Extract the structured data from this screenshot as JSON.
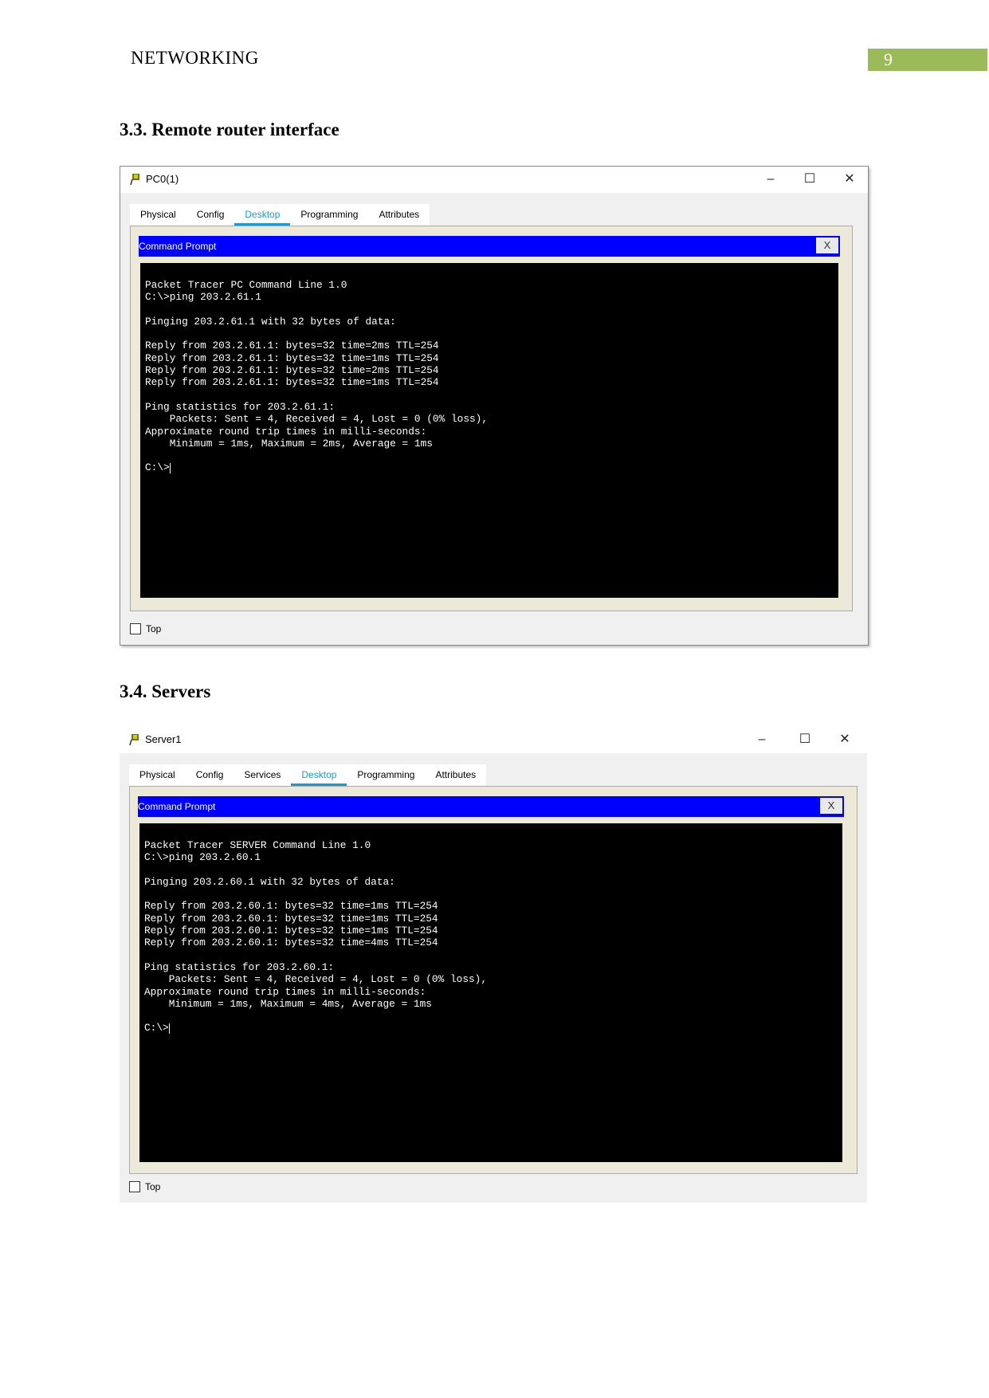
{
  "header": {
    "title": "NETWORKING",
    "page_number": "9",
    "accent_color": "#9bbb59"
  },
  "section1": {
    "heading": "3.3. Remote router interface",
    "window": {
      "title": "PC0(1)",
      "tabs": [
        "Physical",
        "Config",
        "Desktop",
        "Programming",
        "Attributes"
      ],
      "active_tab": "Desktop",
      "cmd_title": "Command Prompt",
      "cmd_close": "X",
      "top_label": "Top",
      "lines": [
        "Packet Tracer PC Command Line 1.0",
        "C:\\>ping 203.2.61.1",
        "",
        "Pinging 203.2.61.1 with 32 bytes of data:",
        "",
        "Reply from 203.2.61.1: bytes=32 time=2ms TTL=254",
        "Reply from 203.2.61.1: bytes=32 time=1ms TTL=254",
        "Reply from 203.2.61.1: bytes=32 time=2ms TTL=254",
        "Reply from 203.2.61.1: bytes=32 time=1ms TTL=254",
        "",
        "Ping statistics for 203.2.61.1:",
        "    Packets: Sent = 4, Received = 4, Lost = 0 (0% loss),",
        "Approximate round trip times in milli-seconds:",
        "    Minimum = 1ms, Maximum = 2ms, Average = 1ms",
        "",
        "C:\\>"
      ]
    }
  },
  "section2": {
    "heading": "3.4. Servers",
    "window": {
      "title": "Server1",
      "tabs": [
        "Physical",
        "Config",
        "Services",
        "Desktop",
        "Programming",
        "Attributes"
      ],
      "active_tab": "Desktop",
      "cmd_title": "Command Prompt",
      "cmd_close": "X",
      "top_label": "Top",
      "lines": [
        "Packet Tracer SERVER Command Line 1.0",
        "C:\\>ping 203.2.60.1",
        "",
        "Pinging 203.2.60.1 with 32 bytes of data:",
        "",
        "Reply from 203.2.60.1: bytes=32 time=1ms TTL=254",
        "Reply from 203.2.60.1: bytes=32 time=1ms TTL=254",
        "Reply from 203.2.60.1: bytes=32 time=1ms TTL=254",
        "Reply from 203.2.60.1: bytes=32 time=4ms TTL=254",
        "",
        "Ping statistics for 203.2.60.1:",
        "    Packets: Sent = 4, Received = 4, Lost = 0 (0% loss),",
        "Approximate round trip times in milli-seconds:",
        "    Minimum = 1ms, Maximum = 4ms, Average = 1ms",
        "",
        "C:\\>"
      ]
    }
  }
}
